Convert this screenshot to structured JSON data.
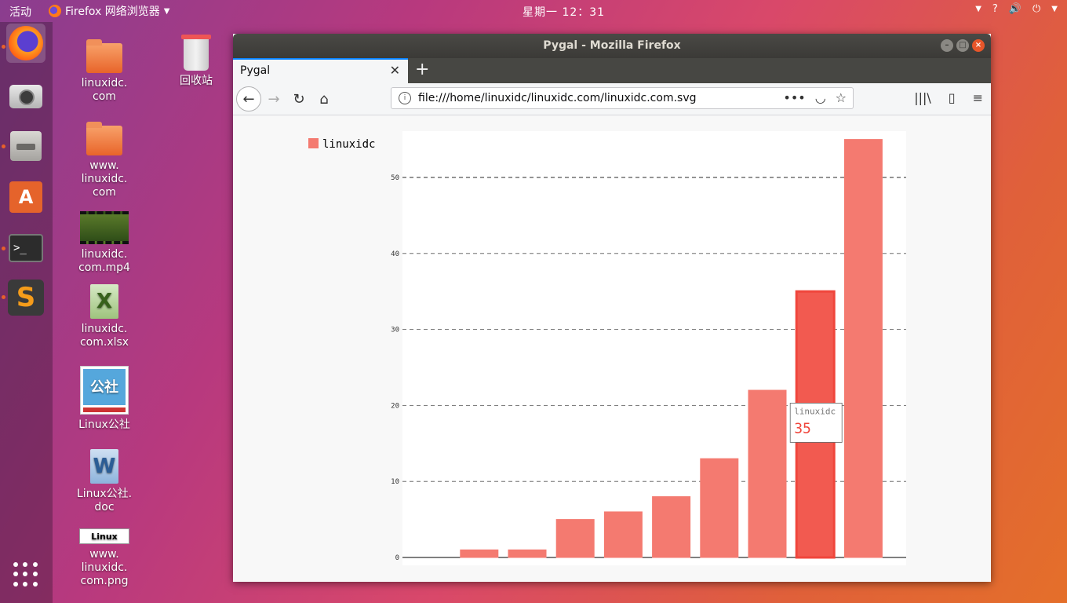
{
  "topbar": {
    "activities": "活动",
    "app_name": "Firefox 网络浏览器",
    "clock": "星期一 12：31"
  },
  "desktop": {
    "icons": [
      {
        "label": "linuxidc.\ncom",
        "icon": "folder-icon"
      },
      {
        "label": "回收站",
        "icon": "trash-icon"
      },
      {
        "label": "www.\nlinuxidc.\ncom",
        "icon": "folder-icon"
      },
      {
        "label": "linuxidc.\ncom.mp4",
        "icon": "video-icon"
      },
      {
        "label": "linuxidc.\ncom.xlsx",
        "icon": "spreadsheet-icon"
      },
      {
        "label": "Linux公社",
        "icon": "image-icon"
      },
      {
        "label": "Linux公社.\ndoc",
        "icon": "document-icon"
      },
      {
        "label": "www.\nlinuxidc.\ncom.png",
        "icon": "image-icon"
      }
    ],
    "thumb_xlsx": "X",
    "thumb_doc": "W",
    "thumb_img": "公社",
    "thumb_png": "Linux"
  },
  "dock": {
    "items": [
      "firefox-icon",
      "camera-icon",
      "files-icon",
      "software-icon",
      "terminal-icon",
      "sublime-icon"
    ],
    "store_glyph": "A",
    "terminal_glyph": ">_",
    "sublime_glyph": "S"
  },
  "window": {
    "title": "Pygal - Mozilla Firefox",
    "tab_title": "Pygal",
    "url": "file:///home/linuxidc/linuxidc.com/linuxidc.com.svg"
  },
  "colors": {
    "bar": "#f47a70",
    "bar_highlight": "#f25a50",
    "tooltip_value": "#f0463c"
  },
  "chart_data": {
    "type": "bar",
    "legend": [
      "linuxidc"
    ],
    "legend_position": "top-left",
    "series": [
      {
        "name": "linuxidc",
        "values": [
          0,
          1,
          1,
          5,
          6,
          8,
          13,
          22,
          35,
          55
        ]
      }
    ],
    "y_ticks": [
      0,
      10,
      20,
      30,
      40,
      50
    ],
    "ylim": [
      0,
      55
    ],
    "grid": true,
    "tooltip": {
      "series": "linuxidc",
      "value": "35",
      "index": 8
    }
  }
}
